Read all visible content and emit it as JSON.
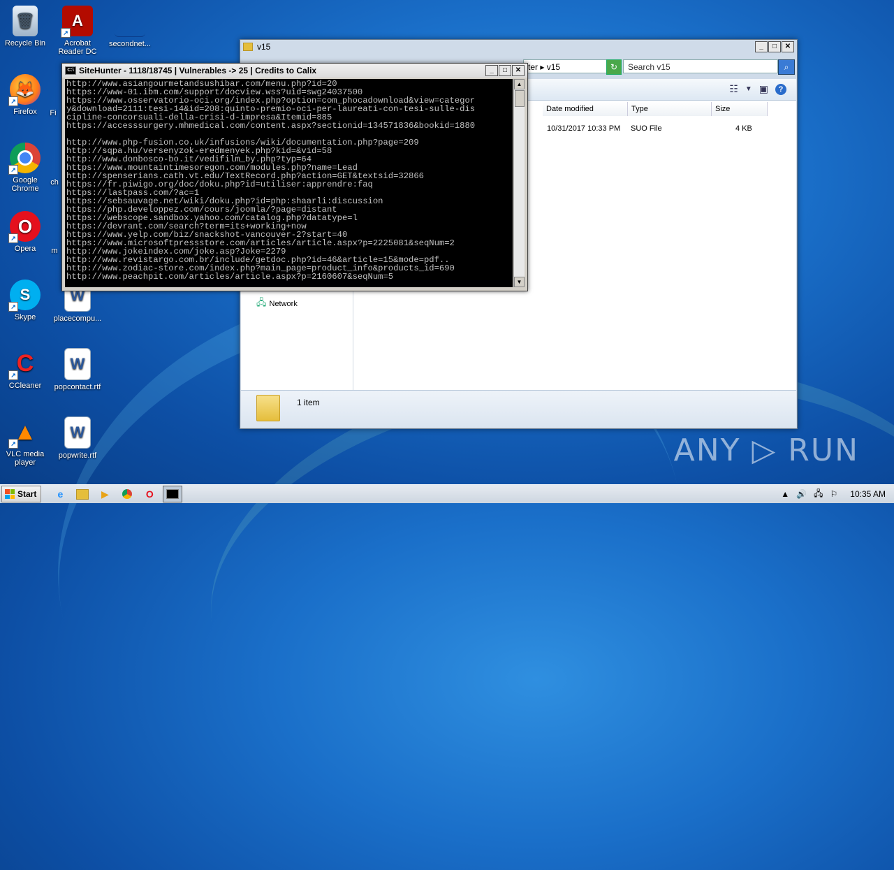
{
  "desktop": {
    "icons": [
      {
        "label": "Recycle Bin"
      },
      {
        "label": "Acrobat Reader DC"
      },
      {
        "label": "secondnet..."
      },
      {
        "label": "Firefox"
      },
      {
        "label": "Google Chrome"
      },
      {
        "label": "Opera"
      },
      {
        "label": "Skype"
      },
      {
        "label": "placecompu..."
      },
      {
        "label": "CCleaner"
      },
      {
        "label": "popcontact.rtf"
      },
      {
        "label": "VLC media player"
      },
      {
        "label": "popwrite.rtf"
      }
    ],
    "partial_labels": [
      "Fi",
      "ch",
      "m"
    ]
  },
  "explorer": {
    "title": "v15",
    "address_tail": "ter ▸ v15",
    "search_placeholder": "Search v15",
    "columns": [
      "Date modified",
      "Type",
      "Size"
    ],
    "file": {
      "date": "10/31/2017 10:33 PM",
      "type": "SUO File",
      "size": "4 KB"
    },
    "nav_network": "Network",
    "status": "1 item"
  },
  "console": {
    "title": "SiteHunter - 1118/18745 | Vulnerables -> 25 | Credits to Calix",
    "lines": "http://www.asiangourmetandsushibar.com/menu.php?id=20\nhttps://www-01.ibm.com/support/docview.wss?uid=swg24037500\nhttps://www.osservatorio-oci.org/index.php?option=com_phocadownload&view=categor\ny&download=2111:tesi-14&id=208:quinto-premio-oci-per-laureati-con-tesi-sulle-dis\ncipline-concorsuali-della-crisi-d-impresa&Itemid=885\nhttps://accesssurgery.mhmedical.com/content.aspx?sectionid=134571836&bookid=1880\n\nhttp://www.php-fusion.co.uk/infusions/wiki/documentation.php?page=209\nhttp://sqpa.hu/versenyzok-eredmenyek.php?kid=&vid=58\nhttp://www.donbosco-bo.it/vedifilm_by.php?typ=64\nhttps://www.mountaintimesoregon.com/modules.php?name=Lead\nhttp://spenserians.cath.vt.edu/TextRecord.php?action=GET&textsid=32866\nhttps://fr.piwigo.org/doc/doku.php?id=utiliser:apprendre:faq\nhttps://lastpass.com/?ac=1\nhttps://sebsauvage.net/wiki/doku.php?id=php:shaarli:discussion\nhttps://php.developpez.com/cours/joomla/?page=distant\nhttps://webscope.sandbox.yahoo.com/catalog.php?datatype=l\nhttps://devrant.com/search?term=its+working+now\nhttps://www.yelp.com/biz/snackshot-vancouver-2?start=40\nhttps://www.microsoftpressstore.com/articles/article.aspx?p=2225081&seqNum=2\nhttp://www.jokeindex.com/joke.asp?Joke=2279\nhttp://www.revistargo.com.br/include/getdoc.php?id=46&article=15&mode=pdf..\nhttp://www.zodiac-store.com/index.php?main_page=product_info&products_id=690\nhttp://www.peachpit.com/articles/article.aspx?p=2160607&seqNum=5"
  },
  "taskbar": {
    "start_label": "Start",
    "clock": "10:35 AM"
  },
  "watermark": "ANY ▷ RUN"
}
